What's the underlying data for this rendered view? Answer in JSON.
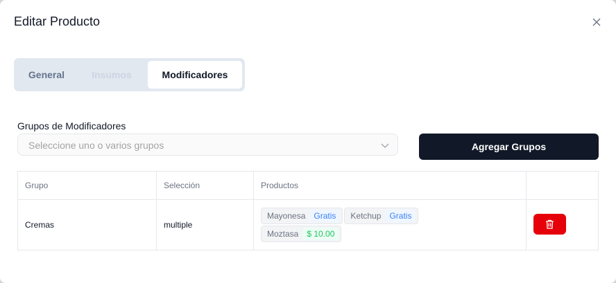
{
  "modal": {
    "title": "Editar Producto"
  },
  "tabs": [
    {
      "label": "General"
    },
    {
      "label": "Insumos"
    },
    {
      "label": "Modificadores"
    }
  ],
  "groups": {
    "label": "Grupos de Modificadores",
    "placeholder": "Seleccione uno o varios grupos",
    "add_button": "Agregar Grupos"
  },
  "table": {
    "headers": [
      "Grupo",
      "Selección",
      "Productos",
      ""
    ],
    "rows": [
      {
        "grupo": "Cremas",
        "seleccion": "multiple",
        "productos": [
          {
            "name": "Mayonesa",
            "tag": "Gratis"
          },
          {
            "name": "Ketchup",
            "tag": "Gratis"
          },
          {
            "name": "Moztasa",
            "tag": "$ 10.00"
          }
        ]
      }
    ]
  },
  "colors": {
    "accent": "#111827",
    "danger": "#e5000a",
    "free": "#3b82f6",
    "price": "#22c55e"
  },
  "icons": {
    "close": "close-icon",
    "chevron": "chevron-down-icon",
    "delete": "trash-icon"
  }
}
